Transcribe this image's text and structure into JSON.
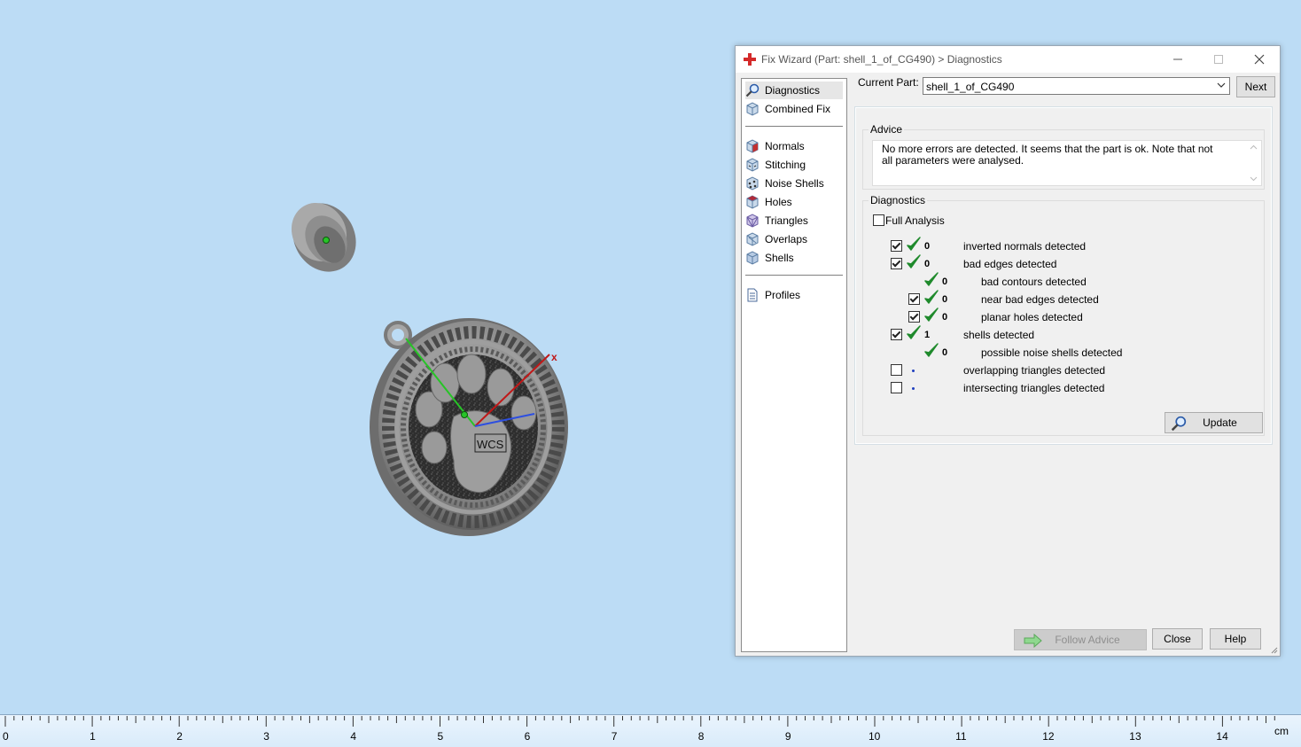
{
  "window": {
    "title": "Fix Wizard (Part: shell_1_of_CG490) > Diagnostics"
  },
  "viewport": {
    "wcs_label": "WCS",
    "axis_x_label": "x"
  },
  "sidebar": {
    "items": [
      {
        "label": "Diagnostics",
        "icon": "magnifier-icon"
      },
      {
        "label": "Combined Fix",
        "icon": "cube-icon"
      },
      {
        "label": "Normals",
        "icon": "normals-cube-icon"
      },
      {
        "label": "Stitching",
        "icon": "stitching-cube-icon"
      },
      {
        "label": "Noise Shells",
        "icon": "noise-shells-icon"
      },
      {
        "label": "Holes",
        "icon": "holes-cube-icon"
      },
      {
        "label": "Triangles",
        "icon": "triangles-cube-icon"
      },
      {
        "label": "Overlaps",
        "icon": "overlaps-cube-icon"
      },
      {
        "label": "Shells",
        "icon": "shells-cube-icon"
      },
      {
        "label": "Profiles",
        "icon": "document-icon"
      }
    ]
  },
  "current_part": {
    "label": "Current Part:",
    "value": "shell_1_of_CG490",
    "next_label": "Next"
  },
  "advice": {
    "group_label": "Advice",
    "text": "No more errors are detected. It seems that the part is ok. Note that not all parameters were analysed."
  },
  "diagnostics": {
    "group_label": "Diagnostics",
    "full_analysis_label": "Full Analysis",
    "full_analysis_checked": false,
    "rows": [
      {
        "count": "0",
        "label": "inverted normals detected",
        "checked": true,
        "status": "ok"
      },
      {
        "count": "0",
        "label": "bad edges detected",
        "checked": true,
        "status": "ok"
      },
      {
        "count": "0",
        "label": "bad contours detected",
        "checked": null,
        "status": "ok"
      },
      {
        "count": "0",
        "label": "near bad edges detected",
        "checked": true,
        "status": "ok"
      },
      {
        "count": "0",
        "label": "planar holes detected",
        "checked": true,
        "status": "ok"
      },
      {
        "count": "1",
        "label": "shells detected",
        "checked": true,
        "status": "ok"
      },
      {
        "count": "0",
        "label": "possible noise shells detected",
        "checked": null,
        "status": "ok"
      },
      {
        "count": "",
        "label": "overlapping triangles detected",
        "checked": false,
        "status": "not-analysed"
      },
      {
        "count": "",
        "label": "intersecting triangles detected",
        "checked": false,
        "status": "not-analysed"
      }
    ],
    "update_label": "Update"
  },
  "footer": {
    "follow_advice_label": "Follow Advice",
    "close_label": "Close",
    "help_label": "Help"
  },
  "ruler": {
    "numbers": [
      "0",
      "1",
      "2",
      "3",
      "4",
      "5",
      "6",
      "7",
      "8",
      "9",
      "10",
      "11",
      "12",
      "13",
      "14"
    ],
    "unit": "cm"
  },
  "colors": {
    "background": "#bcdcf5",
    "ok_check": "#1f8a2c",
    "axis_x": "#c01818",
    "axis_y": "#27c427",
    "axis_z": "#2d4fe0"
  }
}
